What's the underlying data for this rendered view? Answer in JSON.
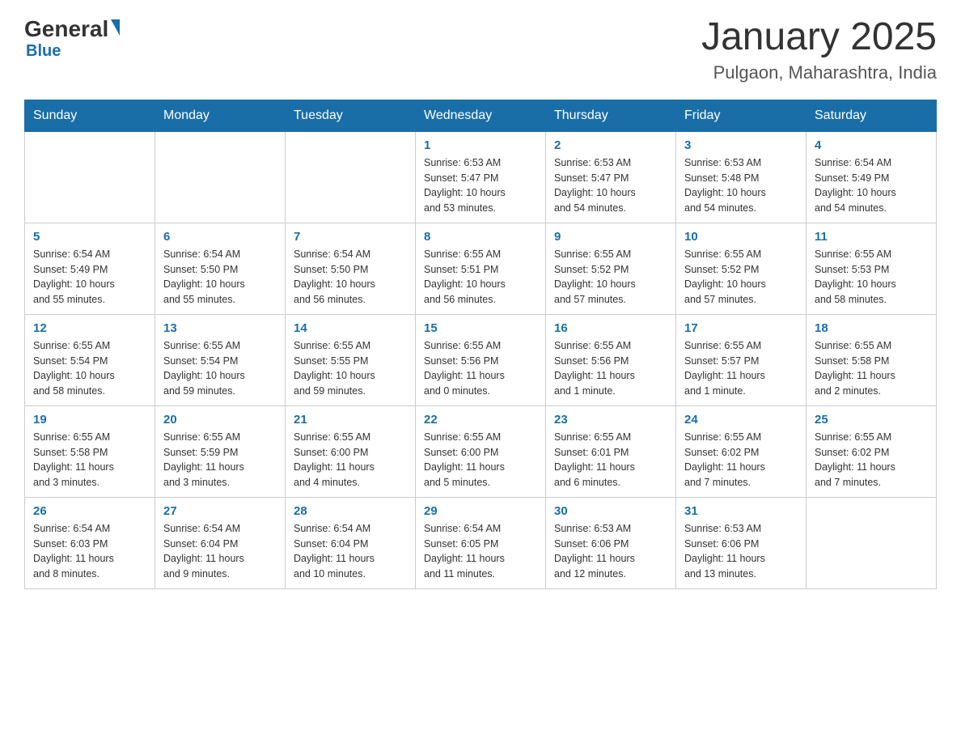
{
  "header": {
    "logo_general": "General",
    "logo_blue": "Blue",
    "month_title": "January 2025",
    "location": "Pulgaon, Maharashtra, India"
  },
  "days_of_week": [
    "Sunday",
    "Monday",
    "Tuesday",
    "Wednesday",
    "Thursday",
    "Friday",
    "Saturday"
  ],
  "weeks": [
    [
      {
        "day": "",
        "info": ""
      },
      {
        "day": "",
        "info": ""
      },
      {
        "day": "",
        "info": ""
      },
      {
        "day": "1",
        "info": "Sunrise: 6:53 AM\nSunset: 5:47 PM\nDaylight: 10 hours\nand 53 minutes."
      },
      {
        "day": "2",
        "info": "Sunrise: 6:53 AM\nSunset: 5:47 PM\nDaylight: 10 hours\nand 54 minutes."
      },
      {
        "day": "3",
        "info": "Sunrise: 6:53 AM\nSunset: 5:48 PM\nDaylight: 10 hours\nand 54 minutes."
      },
      {
        "day": "4",
        "info": "Sunrise: 6:54 AM\nSunset: 5:49 PM\nDaylight: 10 hours\nand 54 minutes."
      }
    ],
    [
      {
        "day": "5",
        "info": "Sunrise: 6:54 AM\nSunset: 5:49 PM\nDaylight: 10 hours\nand 55 minutes."
      },
      {
        "day": "6",
        "info": "Sunrise: 6:54 AM\nSunset: 5:50 PM\nDaylight: 10 hours\nand 55 minutes."
      },
      {
        "day": "7",
        "info": "Sunrise: 6:54 AM\nSunset: 5:50 PM\nDaylight: 10 hours\nand 56 minutes."
      },
      {
        "day": "8",
        "info": "Sunrise: 6:55 AM\nSunset: 5:51 PM\nDaylight: 10 hours\nand 56 minutes."
      },
      {
        "day": "9",
        "info": "Sunrise: 6:55 AM\nSunset: 5:52 PM\nDaylight: 10 hours\nand 57 minutes."
      },
      {
        "day": "10",
        "info": "Sunrise: 6:55 AM\nSunset: 5:52 PM\nDaylight: 10 hours\nand 57 minutes."
      },
      {
        "day": "11",
        "info": "Sunrise: 6:55 AM\nSunset: 5:53 PM\nDaylight: 10 hours\nand 58 minutes."
      }
    ],
    [
      {
        "day": "12",
        "info": "Sunrise: 6:55 AM\nSunset: 5:54 PM\nDaylight: 10 hours\nand 58 minutes."
      },
      {
        "day": "13",
        "info": "Sunrise: 6:55 AM\nSunset: 5:54 PM\nDaylight: 10 hours\nand 59 minutes."
      },
      {
        "day": "14",
        "info": "Sunrise: 6:55 AM\nSunset: 5:55 PM\nDaylight: 10 hours\nand 59 minutes."
      },
      {
        "day": "15",
        "info": "Sunrise: 6:55 AM\nSunset: 5:56 PM\nDaylight: 11 hours\nand 0 minutes."
      },
      {
        "day": "16",
        "info": "Sunrise: 6:55 AM\nSunset: 5:56 PM\nDaylight: 11 hours\nand 1 minute."
      },
      {
        "day": "17",
        "info": "Sunrise: 6:55 AM\nSunset: 5:57 PM\nDaylight: 11 hours\nand 1 minute."
      },
      {
        "day": "18",
        "info": "Sunrise: 6:55 AM\nSunset: 5:58 PM\nDaylight: 11 hours\nand 2 minutes."
      }
    ],
    [
      {
        "day": "19",
        "info": "Sunrise: 6:55 AM\nSunset: 5:58 PM\nDaylight: 11 hours\nand 3 minutes."
      },
      {
        "day": "20",
        "info": "Sunrise: 6:55 AM\nSunset: 5:59 PM\nDaylight: 11 hours\nand 3 minutes."
      },
      {
        "day": "21",
        "info": "Sunrise: 6:55 AM\nSunset: 6:00 PM\nDaylight: 11 hours\nand 4 minutes."
      },
      {
        "day": "22",
        "info": "Sunrise: 6:55 AM\nSunset: 6:00 PM\nDaylight: 11 hours\nand 5 minutes."
      },
      {
        "day": "23",
        "info": "Sunrise: 6:55 AM\nSunset: 6:01 PM\nDaylight: 11 hours\nand 6 minutes."
      },
      {
        "day": "24",
        "info": "Sunrise: 6:55 AM\nSunset: 6:02 PM\nDaylight: 11 hours\nand 7 minutes."
      },
      {
        "day": "25",
        "info": "Sunrise: 6:55 AM\nSunset: 6:02 PM\nDaylight: 11 hours\nand 7 minutes."
      }
    ],
    [
      {
        "day": "26",
        "info": "Sunrise: 6:54 AM\nSunset: 6:03 PM\nDaylight: 11 hours\nand 8 minutes."
      },
      {
        "day": "27",
        "info": "Sunrise: 6:54 AM\nSunset: 6:04 PM\nDaylight: 11 hours\nand 9 minutes."
      },
      {
        "day": "28",
        "info": "Sunrise: 6:54 AM\nSunset: 6:04 PM\nDaylight: 11 hours\nand 10 minutes."
      },
      {
        "day": "29",
        "info": "Sunrise: 6:54 AM\nSunset: 6:05 PM\nDaylight: 11 hours\nand 11 minutes."
      },
      {
        "day": "30",
        "info": "Sunrise: 6:53 AM\nSunset: 6:06 PM\nDaylight: 11 hours\nand 12 minutes."
      },
      {
        "day": "31",
        "info": "Sunrise: 6:53 AM\nSunset: 6:06 PM\nDaylight: 11 hours\nand 13 minutes."
      },
      {
        "day": "",
        "info": ""
      }
    ]
  ]
}
